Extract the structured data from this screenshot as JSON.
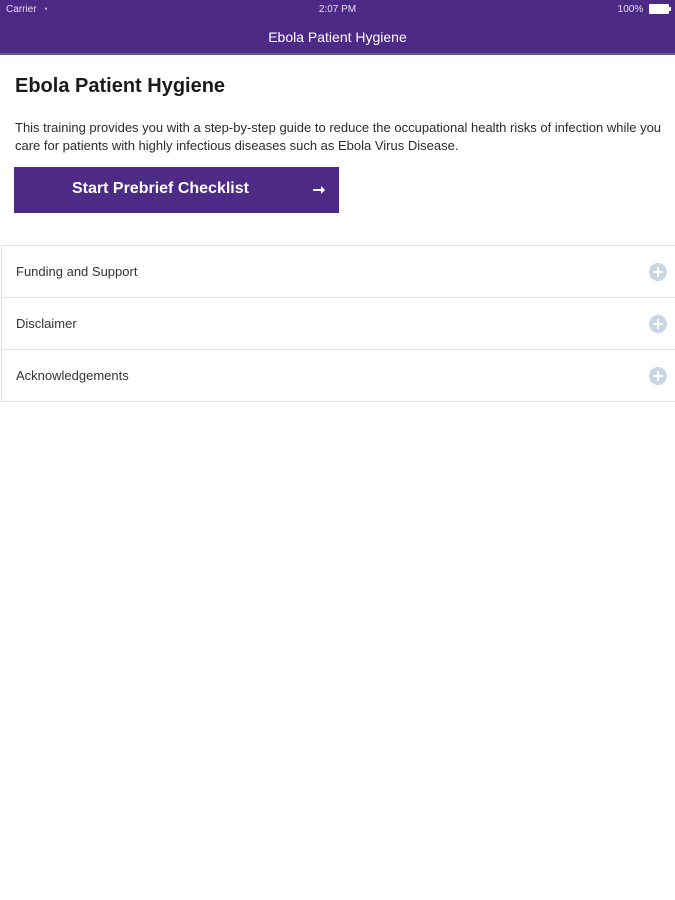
{
  "status_bar": {
    "carrier": "Carrier",
    "time": "2:07 PM",
    "battery": "100%"
  },
  "nav": {
    "title": "Ebola Patient Hygiene"
  },
  "main": {
    "title": "Ebola Patient Hygiene",
    "intro": "This training provides you with a step-by-step guide to reduce the occupational health risks of infection while you care for patients with highly infectious diseases such as Ebola Virus Disease.",
    "cta_label": "Start Prebrief Checklist"
  },
  "accordion": {
    "items": [
      {
        "label": "Funding and Support",
        "icon": "plus-circle-icon"
      },
      {
        "label": "Disclaimer",
        "icon": "plus-circle-icon"
      },
      {
        "label": "Acknowledgements",
        "icon": "plus-circle-icon"
      }
    ]
  },
  "colors": {
    "brand_purple": "#4c2a85",
    "icon_plus": "#c9d6e6",
    "divider": "#e2e2e2"
  }
}
